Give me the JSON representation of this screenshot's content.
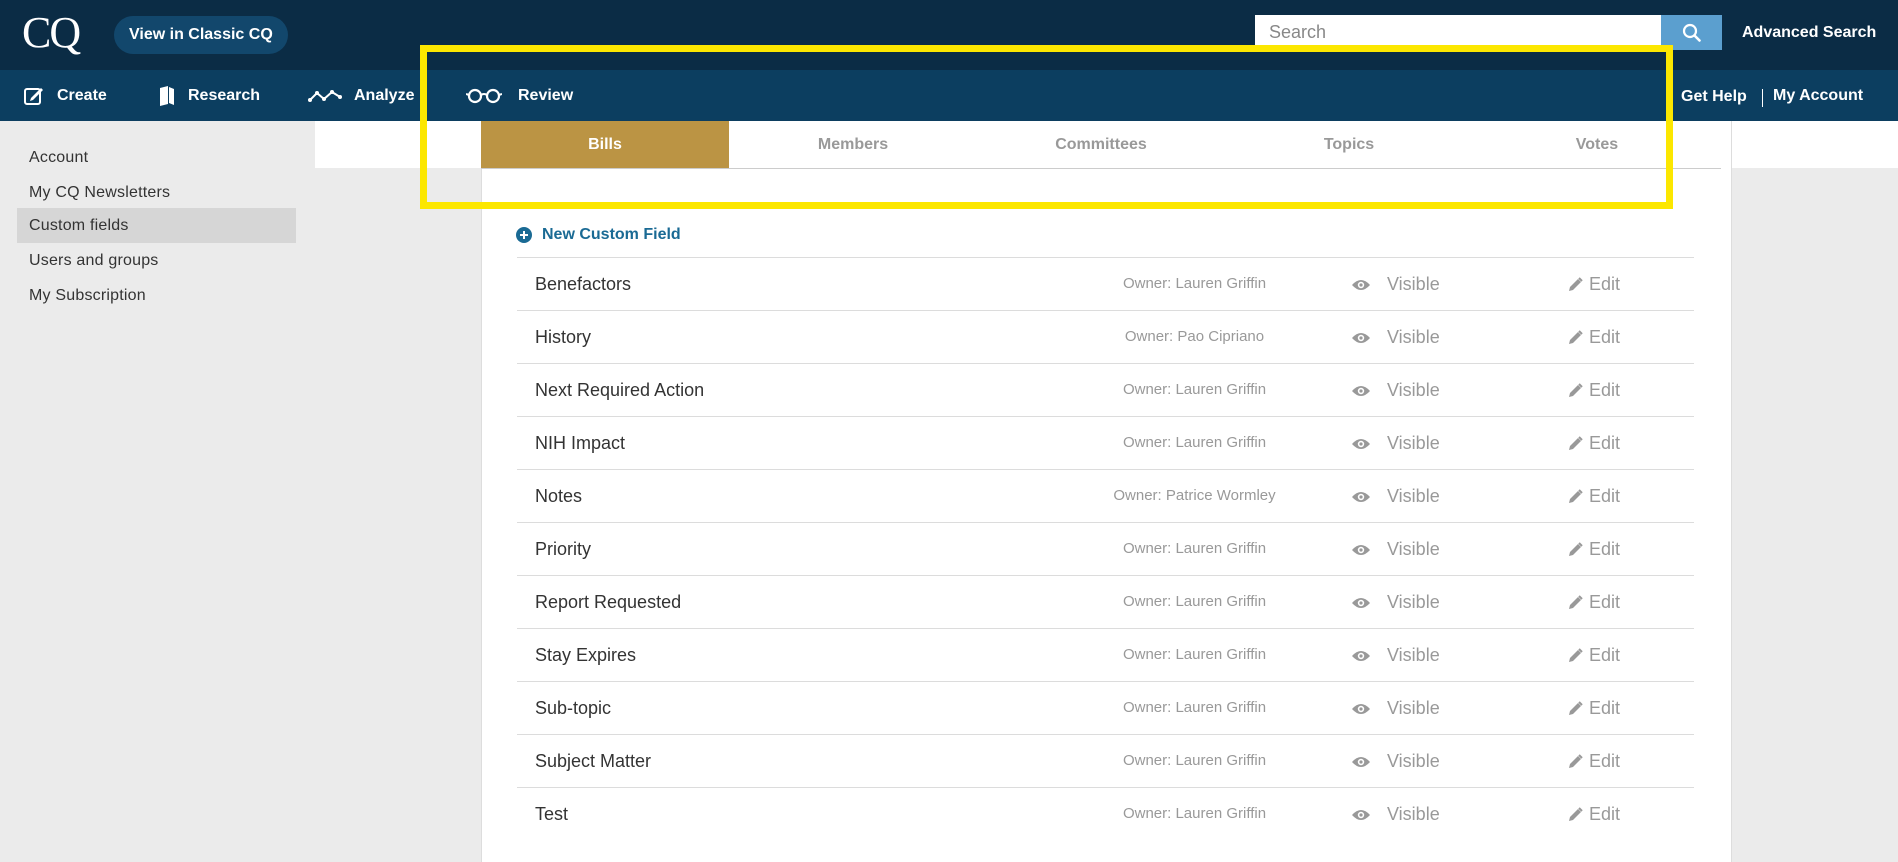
{
  "header": {
    "logo": "CQ",
    "classic_button": "View in Classic CQ",
    "search_placeholder": "Search",
    "advanced_search": "Advanced Search"
  },
  "nav": {
    "items": [
      {
        "label": "Create",
        "icon": "create-icon"
      },
      {
        "label": "Research",
        "icon": "research-icon"
      },
      {
        "label": "Analyze",
        "icon": "analyze-icon"
      },
      {
        "label": "Review",
        "icon": "glasses-icon"
      }
    ],
    "get_help": "Get Help",
    "my_account": "My Account"
  },
  "sidebar": {
    "items": [
      {
        "label": "Account",
        "active": false
      },
      {
        "label": "My CQ Newsletters",
        "active": false
      },
      {
        "label": "Custom fields",
        "active": true
      },
      {
        "label": "Users and groups",
        "active": false
      },
      {
        "label": "My Subscription",
        "active": false
      }
    ]
  },
  "tabs": [
    {
      "label": "Bills",
      "active": true
    },
    {
      "label": "Members",
      "active": false
    },
    {
      "label": "Committees",
      "active": false
    },
    {
      "label": "Topics",
      "active": false
    },
    {
      "label": "Votes",
      "active": false
    }
  ],
  "new_field_label": "New Custom Field",
  "rows": [
    {
      "name": "Benefactors",
      "owner": "Owner: Lauren Griffin",
      "visibility": "Visible",
      "edit": "Edit"
    },
    {
      "name": "History",
      "owner": "Owner: Pao Cipriano",
      "visibility": "Visible",
      "edit": "Edit"
    },
    {
      "name": "Next Required Action",
      "owner": "Owner: Lauren Griffin",
      "visibility": "Visible",
      "edit": "Edit"
    },
    {
      "name": "NIH Impact",
      "owner": "Owner: Lauren Griffin",
      "visibility": "Visible",
      "edit": "Edit"
    },
    {
      "name": "Notes",
      "owner": "Owner: Patrice Wormley",
      "visibility": "Visible",
      "edit": "Edit"
    },
    {
      "name": "Priority",
      "owner": "Owner: Lauren Griffin",
      "visibility": "Visible",
      "edit": "Edit"
    },
    {
      "name": "Report Requested",
      "owner": "Owner: Lauren Griffin",
      "visibility": "Visible",
      "edit": "Edit"
    },
    {
      "name": "Stay Expires",
      "owner": "Owner: Lauren Griffin",
      "visibility": "Visible",
      "edit": "Edit"
    },
    {
      "name": "Sub-topic",
      "owner": "Owner: Lauren Griffin",
      "visibility": "Visible",
      "edit": "Edit"
    },
    {
      "name": "Subject Matter",
      "owner": "Owner: Lauren Griffin",
      "visibility": "Visible",
      "edit": "Edit"
    },
    {
      "name": "Test",
      "owner": "Owner: Lauren Griffin",
      "visibility": "Visible",
      "edit": "Edit"
    }
  ],
  "colors": {
    "topbar": "#0b2c45",
    "navbar": "#0c3e60",
    "active_tab": "#bb9444",
    "link": "#1a6a94",
    "highlight": "#fce700"
  }
}
